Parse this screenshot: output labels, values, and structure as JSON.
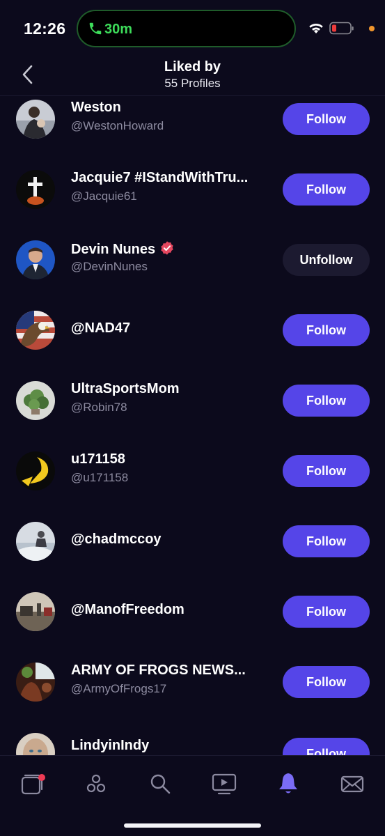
{
  "status_bar": {
    "time": "12:26",
    "call_duration": "30m"
  },
  "header": {
    "title": "Liked by",
    "subtitle": "55 Profiles"
  },
  "profiles": [
    {
      "name": "Weston",
      "handle": "@WestonHoward",
      "button": "Follow",
      "verified": false
    },
    {
      "name": "Jacquie7 #IStandWithTru...",
      "handle": "@Jacquie61",
      "button": "Follow",
      "verified": false
    },
    {
      "name": "Devin Nunes",
      "handle": "@DevinNunes",
      "button": "Unfollow",
      "verified": true
    },
    {
      "name": "@NAD47",
      "handle": "",
      "button": "Follow",
      "verified": false
    },
    {
      "name": "UltraSportsMom",
      "handle": "@Robin78",
      "button": "Follow",
      "verified": false
    },
    {
      "name": "u171158",
      "handle": "@u171158",
      "button": "Follow",
      "verified": false
    },
    {
      "name": "@chadmccoy",
      "handle": "",
      "button": "Follow",
      "verified": false
    },
    {
      "name": "@ManofFreedom",
      "handle": "",
      "button": "Follow",
      "verified": false
    },
    {
      "name": "ARMY OF FROGS NEWS...",
      "handle": "@ArmyOfFrogs17",
      "button": "Follow",
      "verified": false
    },
    {
      "name": "LindyinIndy",
      "handle": "",
      "button": "Follow",
      "verified": false
    }
  ],
  "tabs": [
    "home-icon",
    "groups-icon",
    "search-icon",
    "video-icon",
    "notifications-icon",
    "messages-icon"
  ],
  "colors": {
    "accent": "#5545e8",
    "background": "#0c0a1c",
    "active_tab": "#7b6cf6",
    "call_green": "#3ddc5a",
    "badge": "#ee3b55"
  }
}
